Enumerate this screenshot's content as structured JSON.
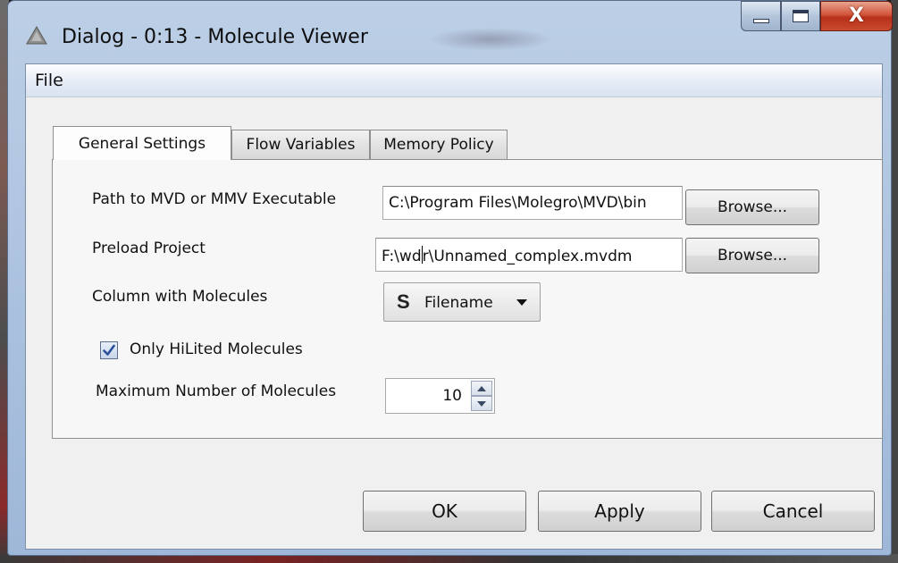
{
  "window": {
    "title": "Dialog - 0:13 - Molecule Viewer",
    "close_symbol": "X"
  },
  "menu": {
    "file_label": "File"
  },
  "tabs": [
    {
      "label": "General Settings",
      "active": true
    },
    {
      "label": "Flow Variables",
      "active": false
    },
    {
      "label": "Memory Policy",
      "active": false
    }
  ],
  "settings": {
    "executable_label": "Path to MVD or MMV Executable",
    "executable_value": "C:\\Program Files\\Molegro\\MVD\\bin",
    "preload_label": "Preload Project",
    "preload_value_before_caret": "F:\\wd",
    "preload_value_after_caret": "r\\Unnamed_complex.mvdm",
    "browse_label": "Browse...",
    "column_label": "Column with Molecules",
    "column_type_glyph": "S",
    "column_value": "Filename",
    "hilited_label": "Only HiLited Molecules",
    "hilited_checked": true,
    "max_label": "Maximum Number of Molecules",
    "max_value": "10"
  },
  "buttons": {
    "ok": "OK",
    "apply": "Apply",
    "cancel": "Cancel"
  },
  "icons": {
    "app": "molecule-app-icon",
    "minimize": "minimize-icon",
    "maximize": "maximize-icon",
    "close": "close-icon",
    "dropdown": "chevron-down-icon",
    "check": "check-icon",
    "spin_up": "spin-up-icon",
    "spin_down": "spin-down-icon"
  },
  "colors": {
    "titlebar": "#bccfe6",
    "close_button": "#c84a2e",
    "dialog_bg": "#f0f0f0",
    "checkmark": "#2a4f9c"
  }
}
